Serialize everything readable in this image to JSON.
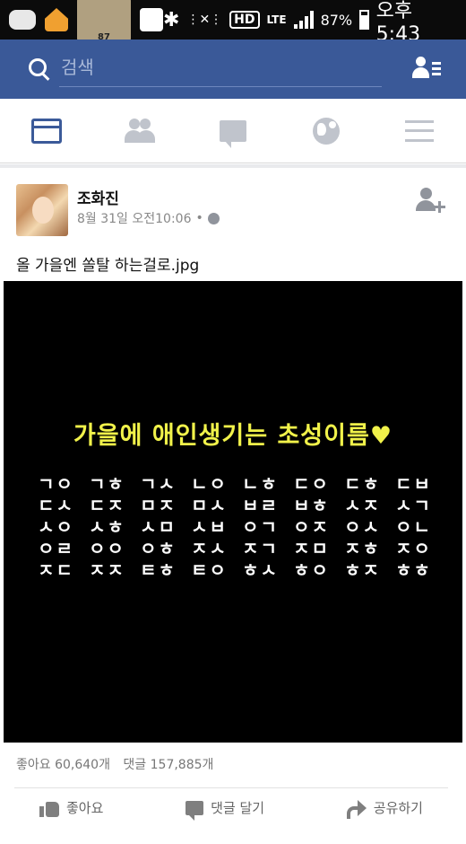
{
  "status_bar": {
    "network": "LTE",
    "hd": "HD",
    "battery": "87%",
    "clock": "오후 5:43",
    "badge": "87"
  },
  "search": {
    "placeholder": "검색"
  },
  "nav_tabs": [
    {
      "icon": "news-feed-icon",
      "active": true
    },
    {
      "icon": "friend-requests-icon",
      "active": false
    },
    {
      "icon": "messages-icon",
      "active": false
    },
    {
      "icon": "notifications-globe-icon",
      "active": false
    },
    {
      "icon": "menu-icon",
      "active": false
    }
  ],
  "post": {
    "author": "조화진",
    "date": "8월 31일 오전10:06",
    "separator": "•",
    "text": "올 가을엔 쏠탈 하는걸로.jpg",
    "image": {
      "title": "가을에 애인생기는 초성이름♥",
      "title_color": "#f1f24a",
      "grid": [
        [
          "ㄱㅇ",
          "ㄱㅎ",
          "ㄱㅅ",
          "ㄴㅇ",
          "ㄴㅎ",
          "ㄷㅇ",
          "ㄷㅎ",
          "ㄷㅂ"
        ],
        [
          "ㄷㅅ",
          "ㄷㅈ",
          "ㅁㅈ",
          "ㅁㅅ",
          "ㅂㄹ",
          "ㅂㅎ",
          "ㅅㅈ",
          "ㅅㄱ"
        ],
        [
          "ㅅㅇ",
          "ㅅㅎ",
          "ㅅㅁ",
          "ㅅㅂ",
          "ㅇㄱ",
          "ㅇㅈ",
          "ㅇㅅ",
          "ㅇㄴ"
        ],
        [
          "ㅇㄹ",
          "ㅇㅇ",
          "ㅇㅎ",
          "ㅈㅅ",
          "ㅈㄱ",
          "ㅈㅁ",
          "ㅈㅎ",
          "ㅈㅇ"
        ],
        [
          "ㅈㄷ",
          "ㅈㅈ",
          "ㅌㅎ",
          "ㅌㅇ",
          "ㅎㅅ",
          "ㅎㅇ",
          "ㅎㅈ",
          "ㅎㅎ"
        ]
      ]
    },
    "likes": "좋아요 60,640개",
    "comments": "댓글 157,885개"
  },
  "actions": {
    "like": "좋아요",
    "comment": "댓글 달기",
    "share": "공유하기"
  },
  "colors": {
    "brand": "#3a5998",
    "active_tab": "#3b5a99",
    "inactive_icon": "#c0c4cc"
  }
}
